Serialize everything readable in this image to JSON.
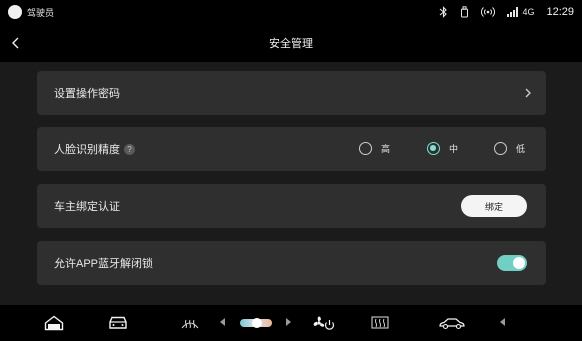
{
  "status_bar": {
    "user": "驾驶员",
    "network": "4G",
    "time": "12:29",
    "icons": [
      "bluetooth-icon",
      "phone-slot-icon",
      "hotspot-icon",
      "signal-icon"
    ]
  },
  "header": {
    "title": "安全管理",
    "back_icon": "chevron-left-icon"
  },
  "settings": {
    "password": {
      "label": "设置操作密码"
    },
    "face": {
      "label": "人脸识别精度",
      "help": "?",
      "options": [
        "高",
        "中",
        "低"
      ],
      "selected": "中"
    },
    "owner": {
      "label": "车主绑定认证",
      "button": "绑定"
    },
    "bluetooth_unlock": {
      "label": "允许APP蓝牙解闭锁",
      "enabled": true
    }
  },
  "dock": {
    "items": [
      "home-icon",
      "car-icon",
      "front-defrost-icon",
      "temperature-slider",
      "fan-power-icon",
      "rear-defrost-icon",
      "vehicle-icon"
    ],
    "accent": "#72cfc4"
  }
}
